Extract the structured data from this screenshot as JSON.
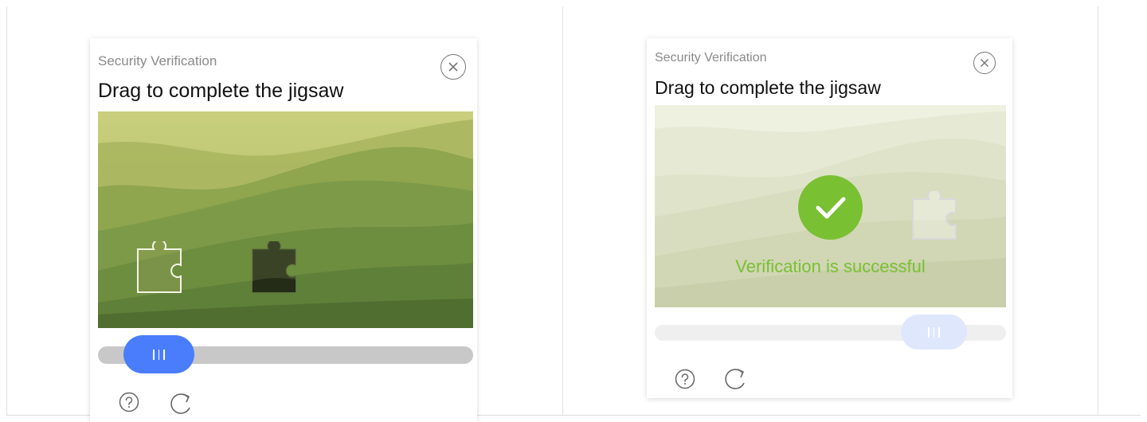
{
  "colors": {
    "accent": "#4a7dfb",
    "success": "#79c032",
    "track": "#c8c8c8",
    "track_done": "#efefef",
    "handle_done": "#dfe7fd"
  },
  "panel_left": {
    "eyebrow": "Security Verification",
    "heading": "Drag to complete the jigsaw",
    "close_icon": "close-circle-icon",
    "slider_progress": 0.07,
    "tools": {
      "help_icon": "help-icon",
      "refresh_icon": "refresh-icon"
    }
  },
  "panel_right": {
    "eyebrow": "Security Verification",
    "heading": "Drag to complete the jigsaw",
    "close_icon": "close-circle-icon",
    "success_text": "Verification is successful",
    "success_icon": "check-circle-icon",
    "slider_progress": 0.8,
    "tools": {
      "help_icon": "help-icon",
      "refresh_icon": "refresh-icon"
    }
  }
}
